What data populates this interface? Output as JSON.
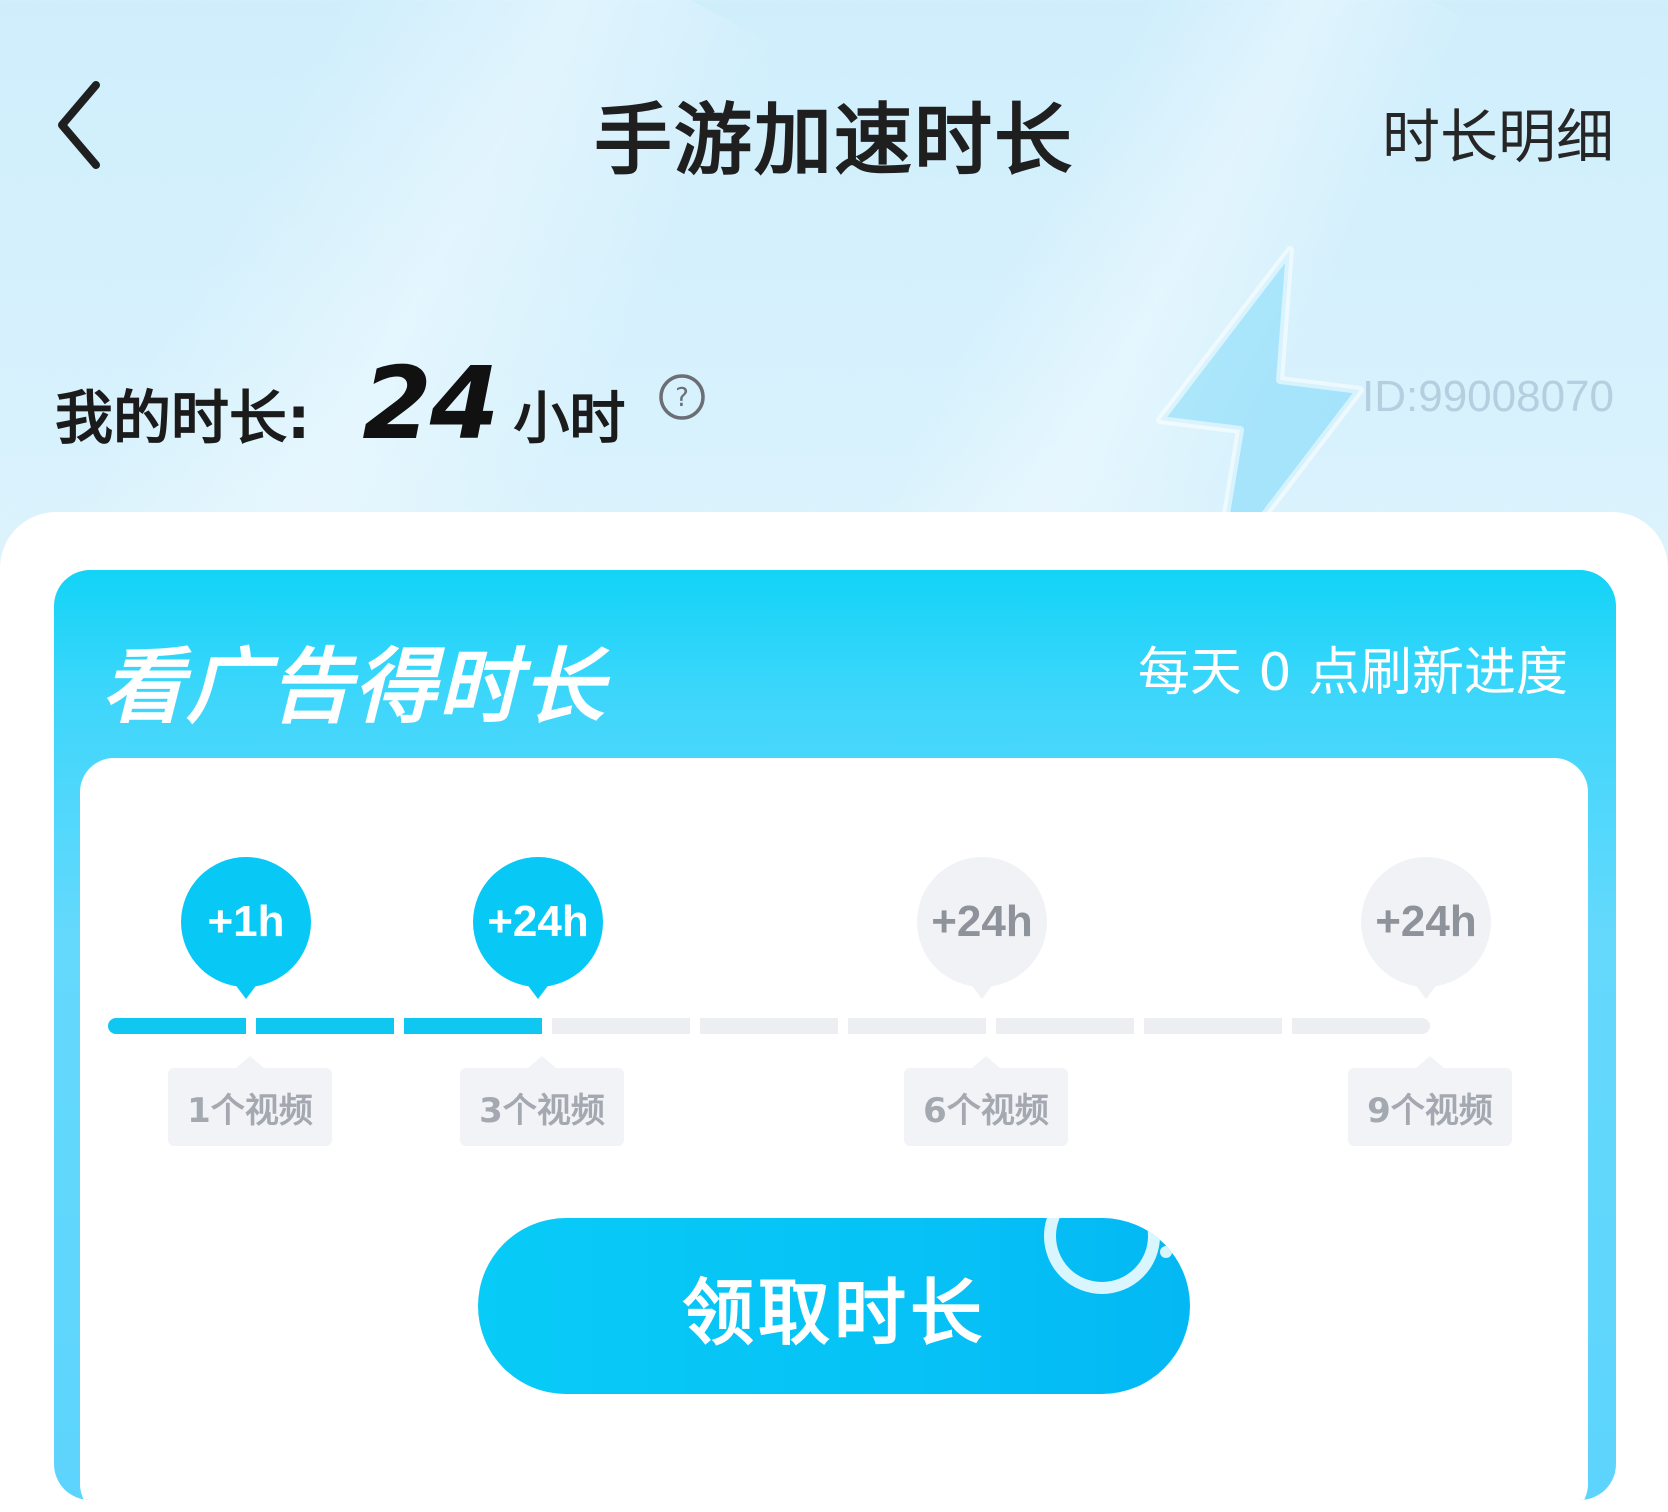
{
  "header": {
    "title": "手游加速时长",
    "detail_link": "时长明细"
  },
  "balance": {
    "label": "我的时长:",
    "value": "24",
    "unit": "小时",
    "user_id": "ID:99008070"
  },
  "ad_card": {
    "title": "看广告得时长",
    "refresh_note": "每天 0 点刷新进度",
    "progress": {
      "segments_total": 9,
      "segments_filled": 3,
      "milestones": [
        {
          "reward": "+1h",
          "label": "1个视频",
          "videos": 1,
          "reached": true
        },
        {
          "reward": "+24h",
          "label": "3个视频",
          "videos": 3,
          "reached": true
        },
        {
          "reward": "+24h",
          "label": "6个视频",
          "videos": 6,
          "reached": false
        },
        {
          "reward": "+24h",
          "label": "9个视频",
          "videos": 9,
          "reached": false
        }
      ]
    },
    "claim_button": "领取时长"
  },
  "colors": {
    "accent": "#08c8f6",
    "track_empty": "#eceef2",
    "inactive_text": "#8e939b"
  },
  "icons": [
    "back-chevron-icon",
    "help-question-icon",
    "lightning-bolt-icon"
  ]
}
